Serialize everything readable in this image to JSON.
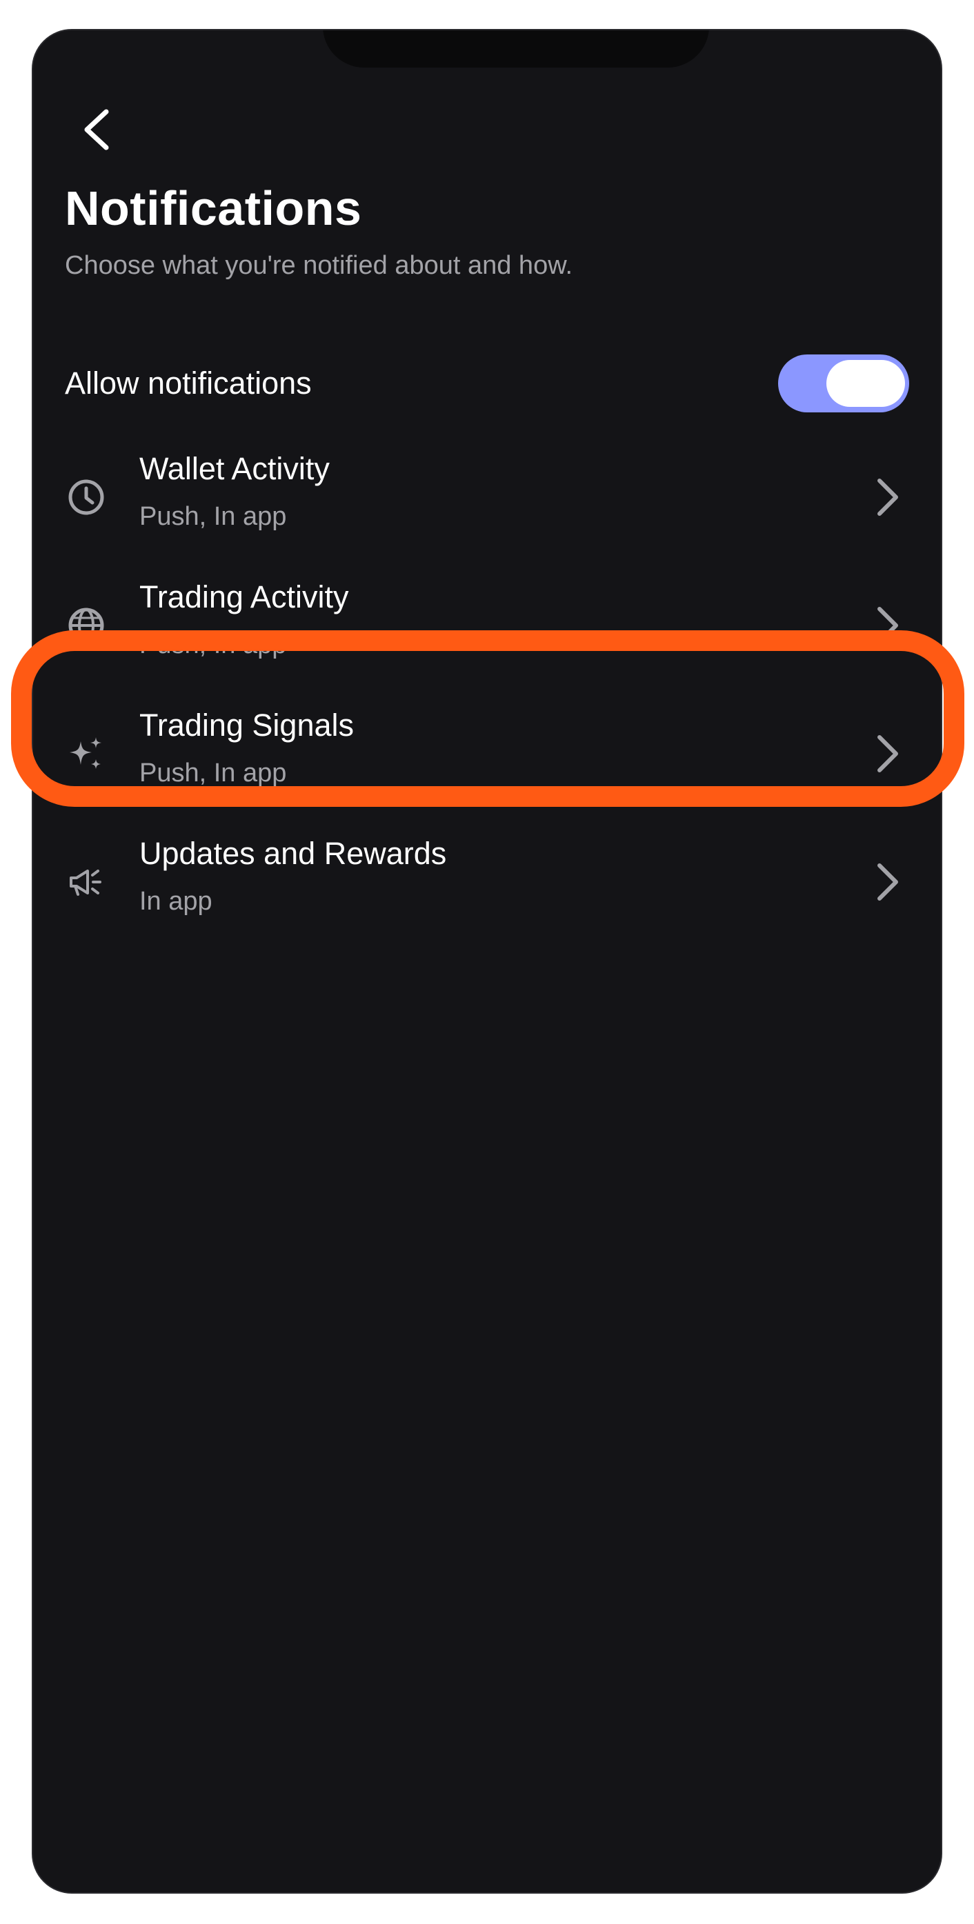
{
  "header": {
    "title": "Notifications",
    "subtitle": "Choose what you're notified about and how."
  },
  "allow": {
    "label": "Allow notifications",
    "enabled": true
  },
  "items": [
    {
      "title": "Wallet Activity",
      "sub": "Push, In app",
      "icon": "clock-icon"
    },
    {
      "title": "Trading Activity",
      "sub": "Push, In app",
      "icon": "globe-icon"
    },
    {
      "title": "Trading Signals",
      "sub": "Push, In app",
      "icon": "sparkle-icon"
    },
    {
      "title": "Updates and Rewards",
      "sub": "In app",
      "icon": "megaphone-icon"
    }
  ],
  "colors": {
    "background": "#141417",
    "toggle_on": "#8b97ff",
    "highlight": "#ff5a14",
    "text_primary": "#ffffff",
    "text_secondary": "#a3a3a8"
  }
}
